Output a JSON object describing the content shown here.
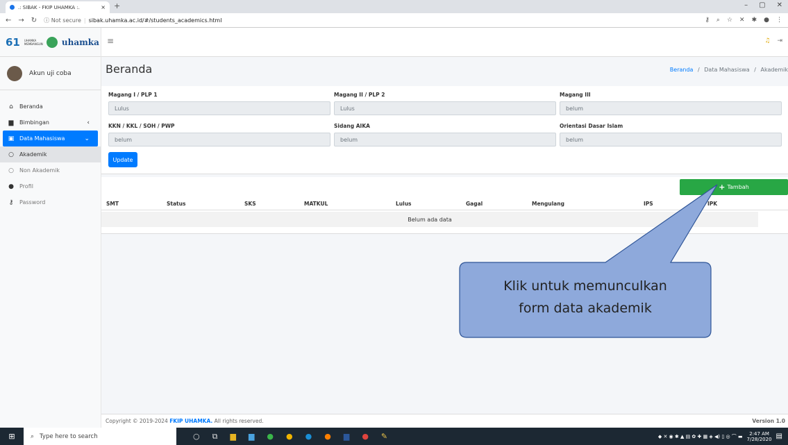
{
  "browser": {
    "tab_title": ".: SIBAK - FKIP UHAMKA :.",
    "new_tab": "+",
    "close_tab": "×",
    "url_secure": "ⓘ Not secure",
    "url_path": "sibak.uhamka.ac.id/#/students_academics.html"
  },
  "sidebar": {
    "brand_number": "61",
    "brand_tagline": "UHAMKA MEMBANGUN",
    "brand_name": "uhamka",
    "user_name": "Akun uji coba",
    "items": [
      {
        "label": "Beranda",
        "icon": "home-icon"
      },
      {
        "label": "Bimbingan",
        "icon": "book-icon"
      },
      {
        "label": "Data Mahasiswa",
        "icon": "id-card-icon"
      },
      {
        "label": "Akademik",
        "icon": "circle-icon"
      },
      {
        "label": "Non Akademik",
        "icon": "circle-icon"
      },
      {
        "label": "Profil",
        "icon": "user-icon"
      },
      {
        "label": "Password",
        "icon": "key-icon"
      }
    ]
  },
  "header": {
    "page_title": "Beranda",
    "breadcrumb": [
      "Beranda",
      "Data Mahasiswa",
      "Akademik"
    ],
    "breadcrumb_sep": "/"
  },
  "form": {
    "fields": [
      {
        "label": "Magang I / PLP 1",
        "value": "Lulus"
      },
      {
        "label": "Magang II / PLP 2",
        "value": "Lulus"
      },
      {
        "label": "Magang III",
        "value": "belum"
      },
      {
        "label": "KKN / KKL / SOH / PWP",
        "value": "belum"
      },
      {
        "label": "Sidang AIKA",
        "value": "belum"
      },
      {
        "label": "Orientasi Dasar Islam",
        "value": "belum"
      }
    ],
    "update_label": "Update"
  },
  "table": {
    "add_label": "Tambah",
    "columns": [
      "SMT",
      "Status",
      "SKS",
      "MATKUL",
      "Lulus",
      "Gagal",
      "Mengulang",
      "IPS",
      "IPK"
    ],
    "empty_text": "Belum ada data"
  },
  "callout": {
    "line1": "Klik untuk memunculkan",
    "line2": "form data akademik"
  },
  "footer": {
    "copyright_prefix": "Copyright © 2019-2024",
    "org": "FKIP UHAMKA.",
    "copyright_suffix": "All rights reserved.",
    "version": "Version 1.0"
  },
  "taskbar": {
    "search_placeholder": "Type here to search",
    "time": "2:47 AM",
    "date": "7/28/2020"
  },
  "colors": {
    "primary": "#007bff",
    "success": "#28a745",
    "callout_fill": "#8ea9db",
    "callout_stroke": "#2f5597"
  }
}
